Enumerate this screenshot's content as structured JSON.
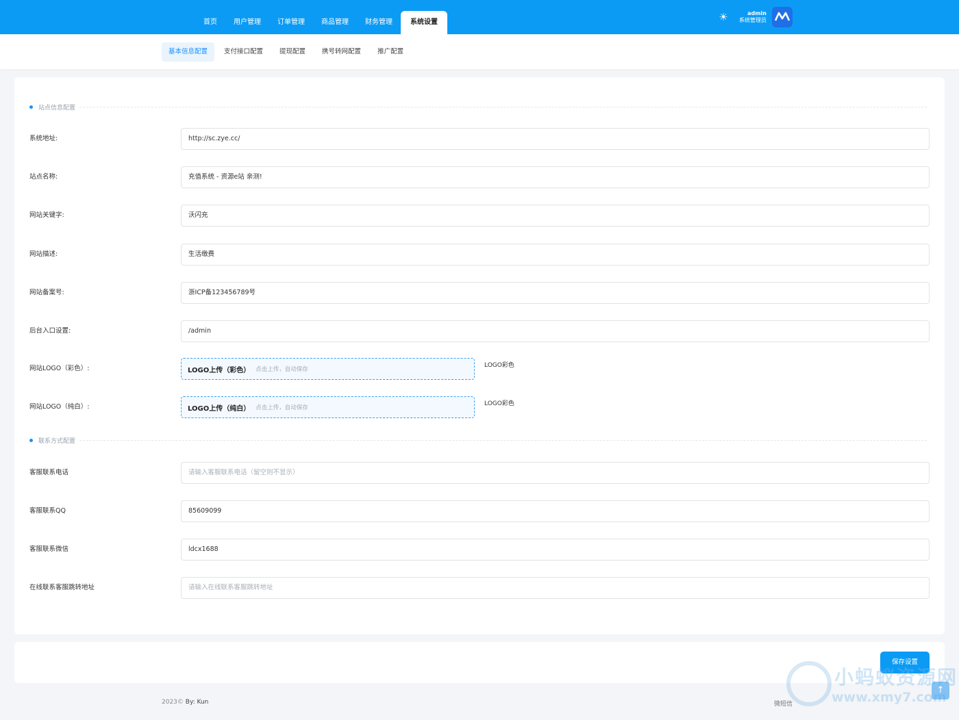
{
  "header": {
    "nav": [
      "首页",
      "用户管理",
      "订单管理",
      "商品管理",
      "财务管理",
      "系统设置"
    ],
    "active_nav": "系统设置",
    "theme_icon": "sun-icon",
    "user_name": "admin",
    "user_role": "系统管理员",
    "avatar_text": "M"
  },
  "subnav": {
    "items": [
      "基本信息配置",
      "支付接口配置",
      "提现配置",
      "携号转网配置",
      "推广配置"
    ],
    "active": "基本信息配置"
  },
  "site_section": {
    "title": "站点信息配置",
    "fields": [
      {
        "label": "系统地址:",
        "value": "http://sc.zye.cc/"
      },
      {
        "label": "站点名称:",
        "value": "充值系统 - 资源e站 亲测!"
      },
      {
        "label": "网站关键字:",
        "value": "沃闪充"
      },
      {
        "label": "网站描述:",
        "value": "生活缴费"
      },
      {
        "label": "网站备案号:",
        "value": "浙ICP备123456789号"
      },
      {
        "label": "后台入口设置:",
        "value": "/admin"
      }
    ],
    "uploads": [
      {
        "label": "网站LOGO（彩色）:",
        "button": "LOGO上传（彩色）",
        "hint": "点击上传，自动保存",
        "side": "LOGO彩色"
      },
      {
        "label": "网站LOGO（纯白）:",
        "button": "LOGO上传（纯白）",
        "hint": "点击上传，自动保存",
        "side": "LOGO彩色"
      }
    ]
  },
  "contact_section": {
    "title": "联系方式配置",
    "fields": [
      {
        "label": "客服联系电话",
        "value": "",
        "placeholder": "请输入客服联系电话（留空则不显示）"
      },
      {
        "label": "客服联系QQ",
        "value": "85609099",
        "placeholder": ""
      },
      {
        "label": "客服联系微信",
        "value": "ldcx1688",
        "placeholder": ""
      },
      {
        "label": "在线联系客服跳转地址",
        "value": "",
        "placeholder": "请输入在线联系客服跳转地址"
      }
    ]
  },
  "save_button": "保存设置",
  "footer": {
    "year": "2023©",
    "by": "By: Kun",
    "wechat": "微短信"
  },
  "watermark": {
    "title": "小蚂蚁资源网",
    "url": "www.xmy7.com"
  },
  "totop_icon": "arrow-up-icon"
}
